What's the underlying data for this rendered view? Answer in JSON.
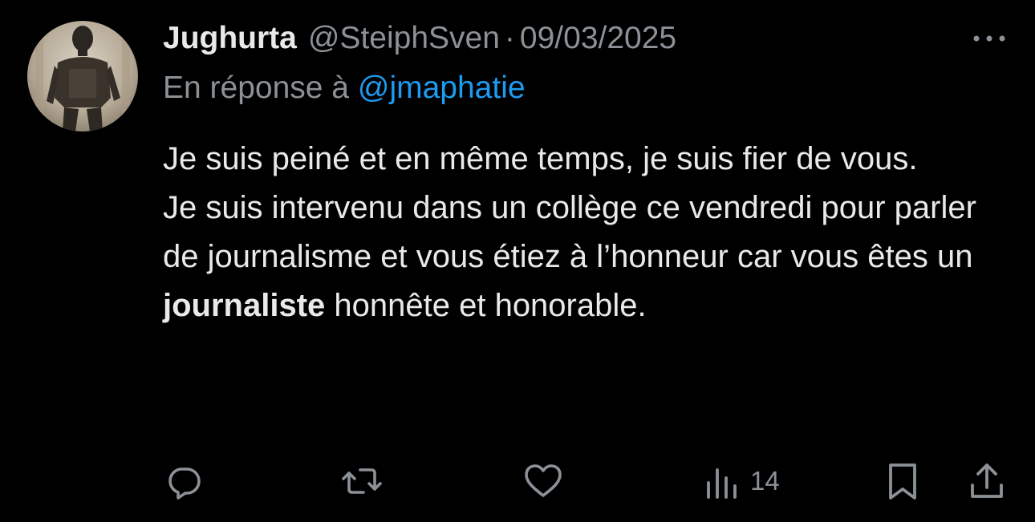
{
  "tweet": {
    "author_name": "Jughurta",
    "author_handle": "@SteiphSven",
    "separator": "·",
    "date": "09/03/2025",
    "reply_prefix": "En réponse à",
    "reply_mention": "@jmaphatie",
    "body": {
      "line1": "Je suis peiné et en même temps, je suis fier de vous.",
      "line2_pre": "Je suis intervenu dans un collège ce vendredi pour parler de journalisme et vous étiez à l’honneur car vous êtes un",
      "line2_bold": "journaliste",
      "line2_post": "honnête et honorable."
    },
    "views_count": "14"
  },
  "icons": {
    "more": "more-icon",
    "reply": "reply-icon",
    "retweet": "retweet-icon",
    "like": "heart-icon",
    "views": "views-icon",
    "bookmark": "bookmark-icon",
    "share": "share-icon"
  },
  "colors": {
    "background": "#000000",
    "primary_text": "#e7e9ea",
    "secondary_text": "#8b9196",
    "mention": "#1d9bf0"
  }
}
